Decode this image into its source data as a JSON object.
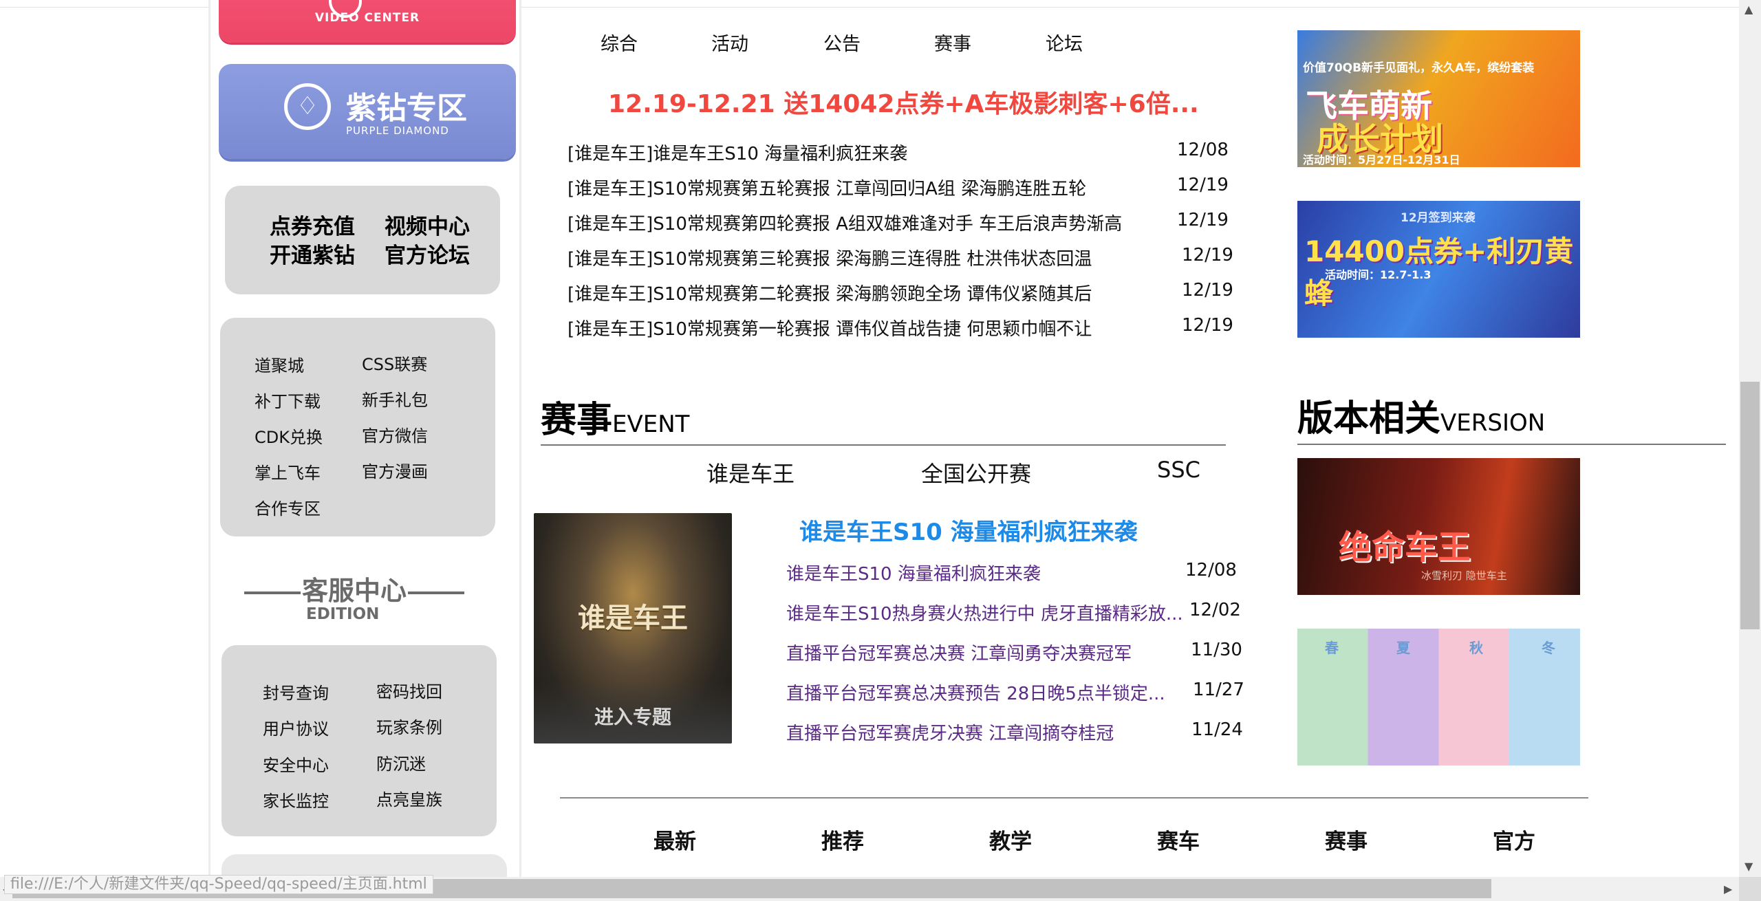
{
  "sidebar": {
    "video_center_sub": "VIDEO CENTER",
    "purple_title": "紫钻专区",
    "purple_sub": "PURPLE DIAMOND",
    "quick_links": [
      "点券充值",
      "视频中心",
      "开通紫钻",
      "官方论坛"
    ],
    "links": [
      "道聚城",
      "CSS联赛",
      "补丁下载",
      "新手礼包",
      "CDK兑换",
      "官方微信",
      "掌上飞车",
      "官方漫画",
      "合作专区"
    ],
    "service_title": "客服中心",
    "service_sub": "EDITION",
    "service_links": [
      "封号查询",
      "密码找回",
      "用户协议",
      "玩家条例",
      "安全中心",
      "防沉迷",
      "家长监控",
      "点亮皇族"
    ]
  },
  "news": {
    "tabs": [
      "综合",
      "活动",
      "公告",
      "赛事",
      "论坛"
    ],
    "headline": "12.19-12.21 送14042点券+A车极影刺客+6倍...",
    "items": [
      {
        "title": "[谁是车王]谁是车王S10 海量福利疯狂来袭",
        "date": "12/08"
      },
      {
        "title": "[谁是车王]S10常规赛第五轮赛报 江章闯回归A组 梁海鹏连胜五轮",
        "date": "12/19"
      },
      {
        "title": "[谁是车王]S10常规赛第四轮赛报 A组双雄难逢对手 车王后浪声势渐高",
        "date": "12/19"
      },
      {
        "title": "[谁是车王]S10常规赛第三轮赛报 梁海鹏三连得胜 杜洪伟状态回温",
        "date": "12/19"
      },
      {
        "title": "[谁是车王]S10常规赛第二轮赛报 梁海鹏领跑全场 谭伟仪紧随其后",
        "date": "12/19"
      },
      {
        "title": "[谁是车王]S10常规赛第一轮赛报 谭伟仪首战告捷 何思颖巾帼不让",
        "date": "12/19"
      }
    ]
  },
  "event": {
    "title": "赛事",
    "title_en": "EVENT",
    "tabs": [
      "谁是车王",
      "全国公开赛",
      "SSC"
    ],
    "image_title": "谁是车王",
    "image_button": "进入专题",
    "headline": "谁是车王S10 海量福利疯狂来袭",
    "items": [
      {
        "title": "谁是车王S10 海量福利疯狂来袭",
        "date": "12/08"
      },
      {
        "title": "谁是车王S10热身赛火热进行中 虎牙直播精彩放...",
        "date": "12/02"
      },
      {
        "title": "直播平台冠军赛总决赛 江章闯勇夺决赛冠军",
        "date": "11/30"
      },
      {
        "title": "直播平台冠军赛总决赛预告 28日晚5点半锁定...",
        "date": "11/27"
      },
      {
        "title": "直播平台冠军赛虎牙决赛 江章闯摘夺桂冠",
        "date": "11/24"
      }
    ]
  },
  "version": {
    "title": "版本相关",
    "title_en": "VERSION"
  },
  "banners": {
    "b1_top": "价值70QB新手见面礼，永久A车，缤纷套装",
    "b1_main1": "飞车萌新",
    "b1_main2": "成长计划",
    "b1_time": "活动时间：5月27日-12月31日",
    "b2_top": "12月签到来袭",
    "b2_main": "14400点券+利刃黄蜂",
    "b2_time": "活动时间：12.7-1.3",
    "b3_main": "绝命车王",
    "b3_sub": "冰雪利刃 隐世车主",
    "b4_labels": [
      "春",
      "夏",
      "秋",
      "冬"
    ]
  },
  "bottom_tabs": [
    "最新",
    "推荐",
    "教学",
    "赛车",
    "赛事",
    "官方"
  ],
  "status_url": "file:///E:/个人/新建文件夹/qq-Speed/qq-speed/主页面.html"
}
